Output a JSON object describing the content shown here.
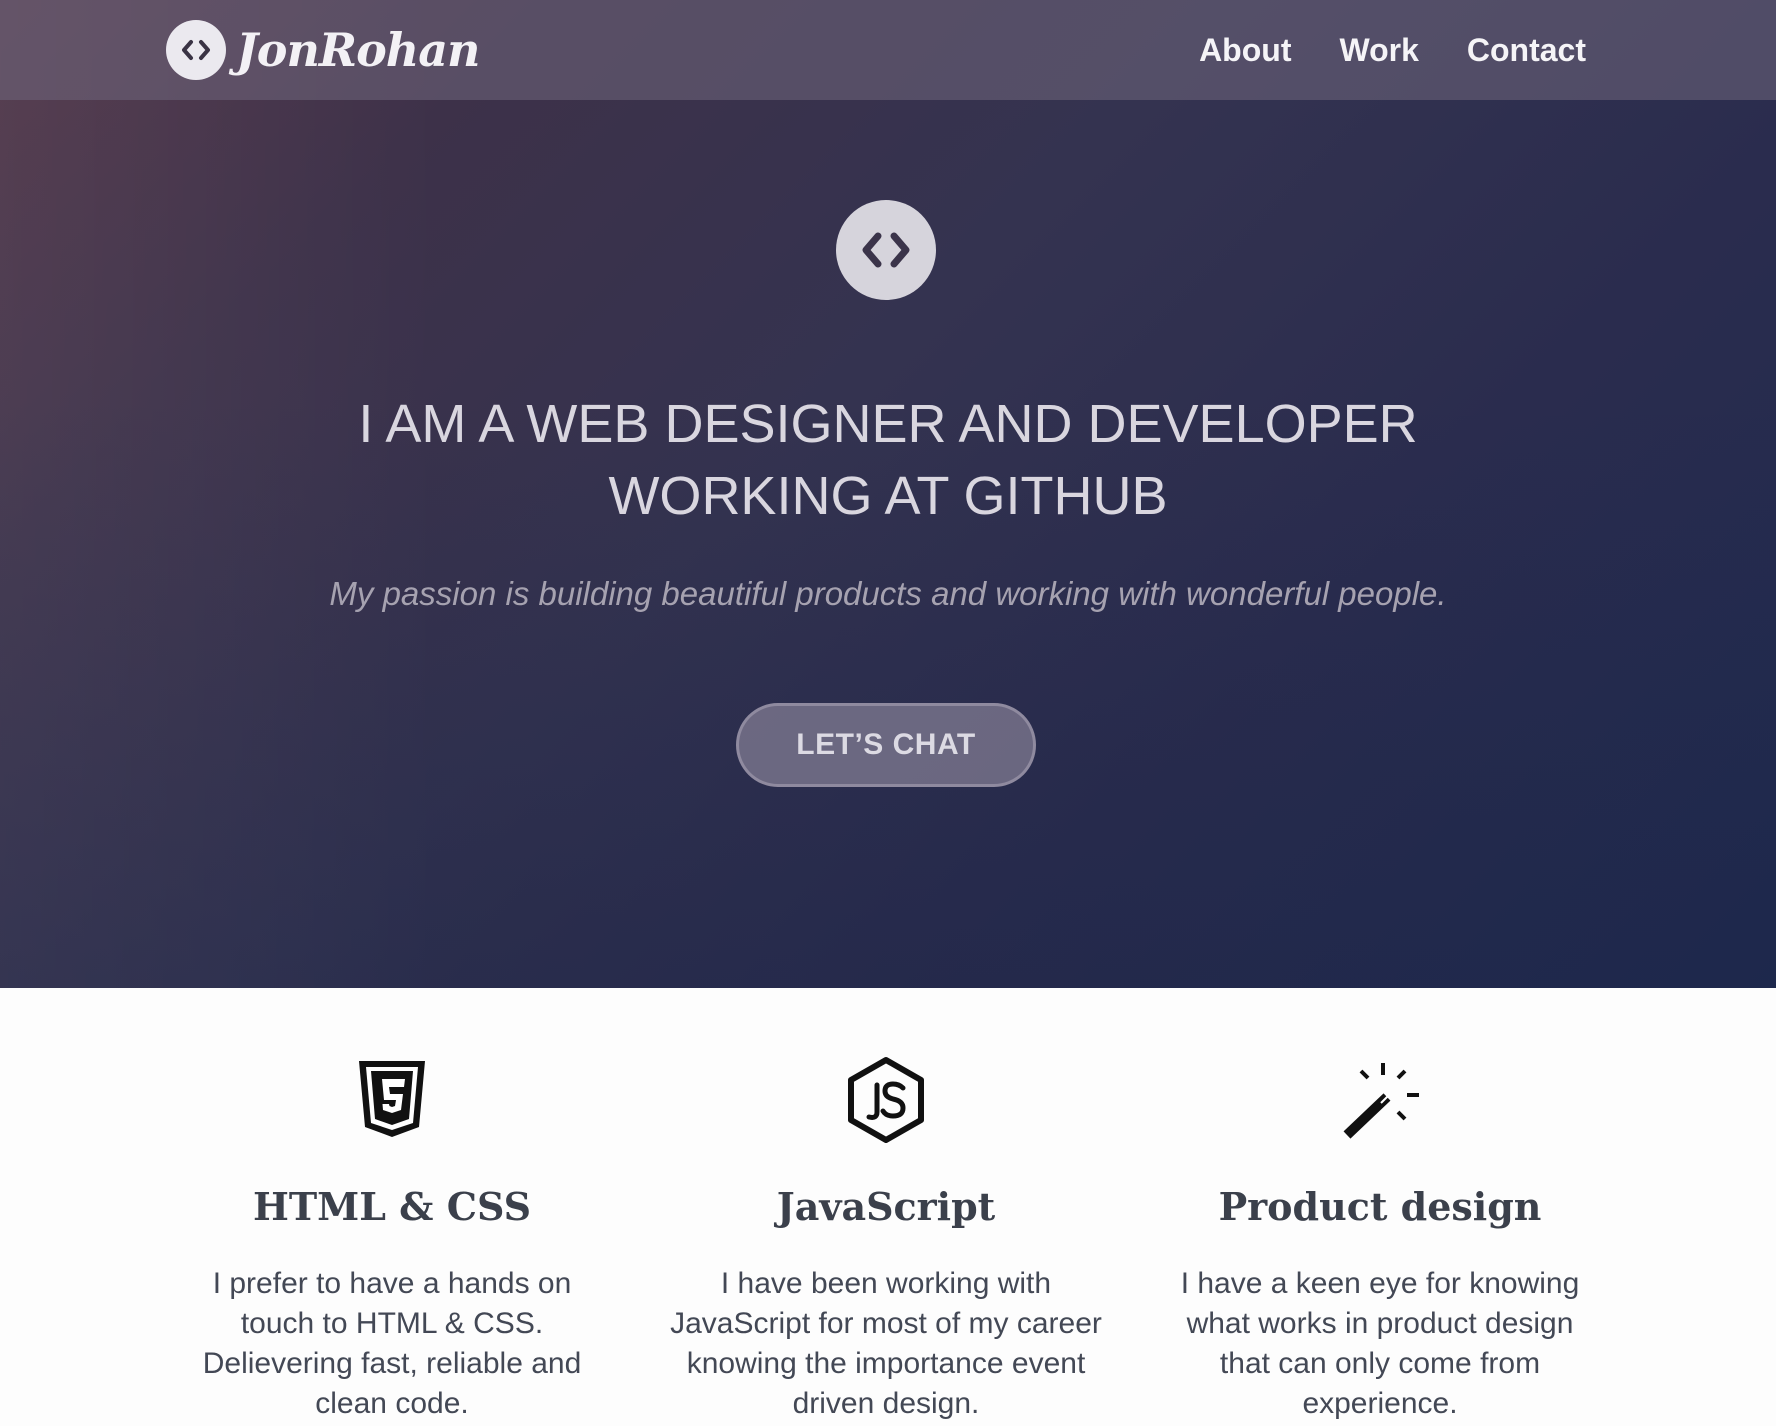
{
  "nav": {
    "logo_text": "JonRohan",
    "logo_icon": "code-brackets-icon",
    "links": [
      {
        "label": "About"
      },
      {
        "label": "Work"
      },
      {
        "label": "Contact"
      }
    ]
  },
  "hero": {
    "icon": "code-brackets-icon",
    "headline_line1": "I AM A WEB DESIGNER AND DEVELOPER",
    "headline_line2": "WORKING AT GITHUB",
    "tagline": "My passion is building beautiful products and working with wonderful people.",
    "cta_label": "LET’S CHAT"
  },
  "skills": [
    {
      "icon": "html5-icon",
      "title": "HTML & CSS",
      "text": "I prefer to have a hands on touch to HTML & CSS. Delievering fast, reliable and clean code."
    },
    {
      "icon": "nodejs-icon",
      "title": "JavaScript",
      "text": "I have been working with JavaScript for most of my career knowing the importance event driven design."
    },
    {
      "icon": "magic-wand-icon",
      "title": "Product design",
      "text": "I have a keen eye for knowing what works in product design that can only come from experience."
    }
  ],
  "colors": {
    "nav_bg": "#5a5065",
    "hero_gradient_start": "#4e3245",
    "hero_gradient_end": "#1f2a4f",
    "cta_bg": "#7d7890",
    "text_dark": "#3b404b"
  }
}
